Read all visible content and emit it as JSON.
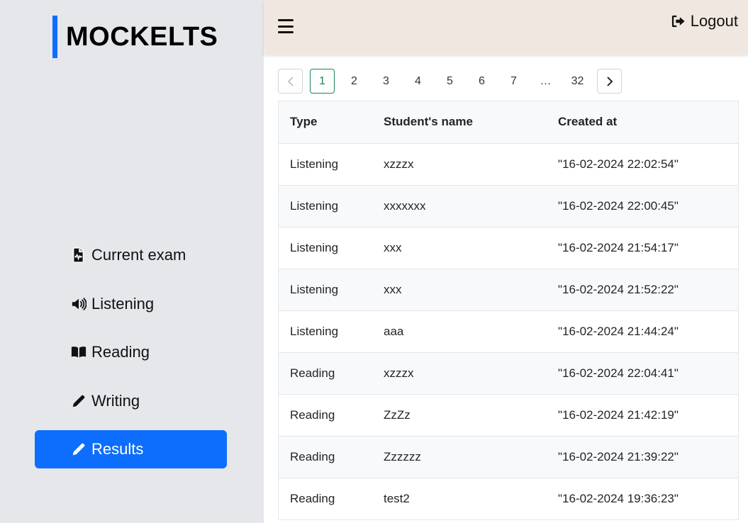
{
  "app": {
    "logo_text": "MOCKELTS",
    "accent_color": "#0d6efd"
  },
  "sidebar": {
    "items": [
      {
        "label": "Current exam",
        "icon": "file-audio-icon",
        "active": false
      },
      {
        "label": "Listening",
        "icon": "volume-icon",
        "active": false
      },
      {
        "label": "Reading",
        "icon": "book-open-icon",
        "active": false
      },
      {
        "label": "Writing",
        "icon": "pencil-icon",
        "active": false
      },
      {
        "label": "Results",
        "icon": "pencil-icon",
        "active": true
      }
    ]
  },
  "topbar": {
    "menu_icon": "hamburger-icon",
    "logout_label": "Logout",
    "logout_icon": "sign-out-icon"
  },
  "pagination": {
    "prev_icon": "chevron-left-icon",
    "next_icon": "chevron-right-icon",
    "current": "1",
    "pages": [
      "1",
      "2",
      "3",
      "4",
      "5",
      "6",
      "7",
      "…",
      "32"
    ]
  },
  "table": {
    "headers": {
      "type": "Type",
      "name": "Student's name",
      "created": "Created at"
    },
    "rows": [
      {
        "type": "Listening",
        "name": "xzzzx",
        "created": "\"16-02-2024 22:02:54\""
      },
      {
        "type": "Listening",
        "name": "xxxxxxx",
        "created": "\"16-02-2024 22:00:45\""
      },
      {
        "type": "Listening",
        "name": "xxx",
        "created": "\"16-02-2024 21:54:17\""
      },
      {
        "type": "Listening",
        "name": "xxx",
        "created": "\"16-02-2024 21:52:22\""
      },
      {
        "type": "Listening",
        "name": "aaa",
        "created": "\"16-02-2024 21:44:24\""
      },
      {
        "type": "Reading",
        "name": "xzzzx",
        "created": "\"16-02-2024 22:04:41\""
      },
      {
        "type": "Reading",
        "name": "ZzZz",
        "created": "\"16-02-2024 21:42:19\""
      },
      {
        "type": "Reading",
        "name": "Zzzzzz",
        "created": "\"16-02-2024 21:39:22\""
      },
      {
        "type": "Reading",
        "name": "test2",
        "created": "\"16-02-2024 19:36:23\""
      }
    ]
  }
}
